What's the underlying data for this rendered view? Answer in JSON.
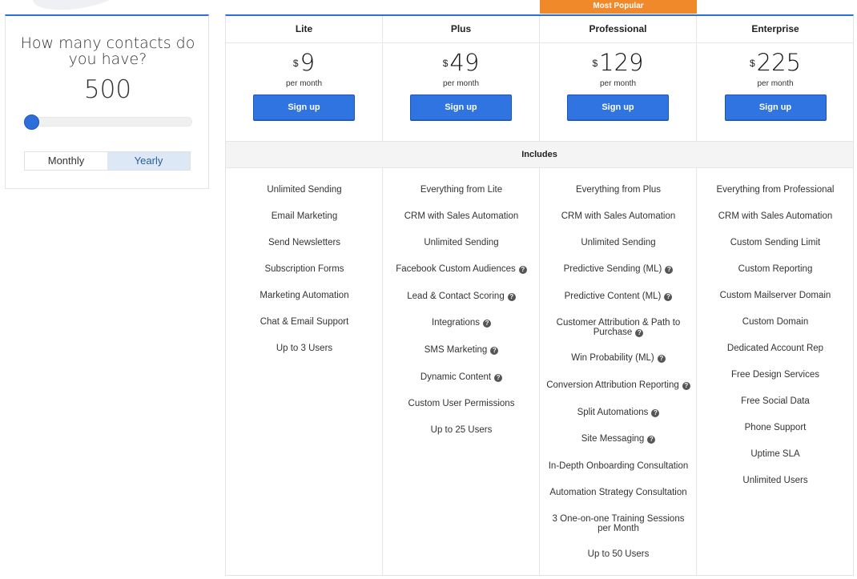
{
  "contacts": {
    "question": "How many contacts do you have?",
    "count": "500",
    "slider_fraction": 0.0
  },
  "billing": {
    "monthly_label": "Monthly",
    "yearly_label": "Yearly",
    "active": "yearly"
  },
  "badge": "Most Popular",
  "includes_label": "Includes",
  "currency_symbol": "$",
  "per_month_label": "per month",
  "signup_label": "Sign up",
  "help_glyph": "?",
  "plans": [
    {
      "name": "Lite",
      "price": "9",
      "features": [
        {
          "text": "Unlimited Sending",
          "help": false
        },
        {
          "text": "Email Marketing",
          "help": false
        },
        {
          "text": "Send Newsletters",
          "help": false
        },
        {
          "text": "Subscription Forms",
          "help": false
        },
        {
          "text": "Marketing Automation",
          "help": false
        },
        {
          "text": "Chat & Email Support",
          "help": false
        },
        {
          "text": "Up to 3 Users",
          "help": false
        }
      ]
    },
    {
      "name": "Plus",
      "price": "49",
      "features": [
        {
          "text": "Everything from Lite",
          "help": false
        },
        {
          "text": "CRM with Sales Automation",
          "help": false
        },
        {
          "text": "Unlimited Sending",
          "help": false
        },
        {
          "text": "Facebook Custom Audiences",
          "help": true
        },
        {
          "text": "Lead & Contact Scoring",
          "help": true
        },
        {
          "text": "Integrations",
          "help": true
        },
        {
          "text": "SMS Marketing",
          "help": true
        },
        {
          "text": "Dynamic Content",
          "help": true
        },
        {
          "text": "Custom User Permissions",
          "help": false
        },
        {
          "text": "Up to 25 Users",
          "help": false
        }
      ]
    },
    {
      "name": "Professional",
      "price": "129",
      "features": [
        {
          "text": "Everything from Plus",
          "help": false
        },
        {
          "text": "CRM with Sales Automation",
          "help": false
        },
        {
          "text": "Unlimited Sending",
          "help": false
        },
        {
          "text": "Predictive Sending (ML)",
          "help": true
        },
        {
          "text": "Predictive Content (ML)",
          "help": true
        },
        {
          "text": "Customer Attribution & Path to Purchase",
          "help": true
        },
        {
          "text": "Win Probability (ML)",
          "help": true
        },
        {
          "text": "Conversion Attribution Reporting",
          "help": true
        },
        {
          "text": "Split Automations",
          "help": true
        },
        {
          "text": "Site Messaging",
          "help": true
        },
        {
          "text": "In-Depth Onboarding Consultation",
          "help": false
        },
        {
          "text": "Automation Strategy Consultation",
          "help": false
        },
        {
          "text": "3 One-on-one Training Sessions per Month",
          "help": false
        },
        {
          "text": "Up to 50 Users",
          "help": false
        }
      ]
    },
    {
      "name": "Enterprise",
      "price": "225",
      "features": [
        {
          "text": "Everything from Professional",
          "help": false
        },
        {
          "text": "CRM with Sales Automation",
          "help": false
        },
        {
          "text": "Custom Sending Limit",
          "help": false
        },
        {
          "text": "Custom Reporting",
          "help": false
        },
        {
          "text": "Custom Mailserver Domain",
          "help": false
        },
        {
          "text": "Custom Domain",
          "help": false
        },
        {
          "text": "Dedicated Account Rep",
          "help": false
        },
        {
          "text": "Free Design Services",
          "help": false
        },
        {
          "text": "Free Social Data",
          "help": false
        },
        {
          "text": "Phone Support",
          "help": false
        },
        {
          "text": "Uptime SLA",
          "help": false
        },
        {
          "text": "Unlimited Users",
          "help": false
        }
      ]
    }
  ]
}
